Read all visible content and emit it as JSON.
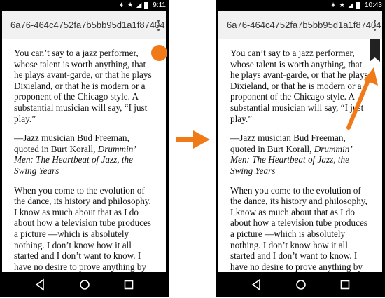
{
  "left_phone": {
    "status": {
      "time": "9:11",
      "icons": [
        "bluetooth-icon",
        "star-icon",
        "signal-icon",
        "battery-icon"
      ]
    },
    "url": "6a76-464c4752fa7b5bb95d1a1f87404",
    "menu_icon": "more-vert-icon"
  },
  "right_phone": {
    "status": {
      "time": "10:43",
      "icons": [
        "bluetooth-icon",
        "star-icon",
        "signal-icon",
        "battery-icon"
      ]
    },
    "url": "6a76-464c4752fa7b5bb95d1a1f87404",
    "menu_icon": "more-vert-icon"
  },
  "article": {
    "para1": "You can’t say to a jazz performer, whose talent is worth anything, that he plays avant-garde, or that he plays Dixieland, or that he is modern or a proponent of the Chicago style. A substantial musician will say, “I just play.”",
    "attribution_prefix": "—Jazz musician Bud Freeman, quoted in Burt Korall, ",
    "attribution_title": "Drummin’ Men: The Heartbeat of Jazz, the Swing Years",
    "para2": "When you come to the evolution of the dance, its history and philosophy, I know as much about that as I do about how a television tube produces a picture —which is absolutely nothing. I don’t know how it all started and I don’t want to know. I have no desire to prove anything by it. I have never used it as an"
  },
  "navbar": {
    "icons": [
      "back-icon",
      "home-icon",
      "recents-icon"
    ]
  },
  "colors": {
    "accent": "#f07a17",
    "urlbar": "#f1f1f1",
    "bezel": "#000000",
    "handle": "#222222"
  }
}
